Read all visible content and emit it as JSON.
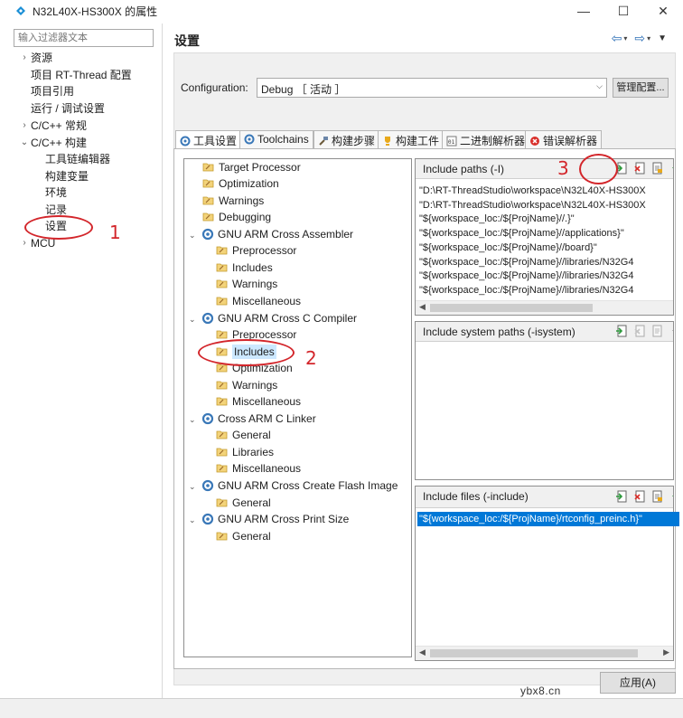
{
  "window": {
    "title": "N32L40X-HS300X 的属性",
    "controls": {
      "minimize": "—",
      "maximize": "☐",
      "close": "✕"
    }
  },
  "left": {
    "filter_placeholder": "输入过滤器文本",
    "items": [
      {
        "label": "资源",
        "arrow": "›"
      },
      {
        "label": "项目 RT-Thread 配置",
        "arrow": ""
      },
      {
        "label": "项目引用",
        "arrow": ""
      },
      {
        "label": "运行 / 调试设置",
        "arrow": ""
      },
      {
        "label": "C/C++ 常规",
        "arrow": "›"
      },
      {
        "label": "C/C++ 构建",
        "arrow": "⌄"
      },
      {
        "label": "工具链编辑器",
        "arrow": ""
      },
      {
        "label": "构建变量",
        "arrow": ""
      },
      {
        "label": "环境",
        "arrow": ""
      },
      {
        "label": "记录",
        "arrow": ""
      },
      {
        "label": "设置",
        "arrow": ""
      },
      {
        "label": "MCU",
        "arrow": "›"
      }
    ]
  },
  "header": {
    "title": "设置"
  },
  "config": {
    "label": "Configuration:",
    "value": "Debug ［ 活动 ］",
    "manage_button": "管理配置..."
  },
  "tabs": [
    {
      "label": "工具设置"
    },
    {
      "label": "Toolchains"
    },
    {
      "label": "构建步骤"
    },
    {
      "label": "构建工件"
    },
    {
      "label": "二进制解析器"
    },
    {
      "label": "错误解析器"
    }
  ],
  "tree": {
    "nodes": [
      {
        "label": "Target Processor"
      },
      {
        "label": "Optimization"
      },
      {
        "label": "Warnings"
      },
      {
        "label": "Debugging"
      },
      {
        "label": "GNU ARM Cross Assembler"
      },
      {
        "label": "Preprocessor"
      },
      {
        "label": "Includes"
      },
      {
        "label": "Warnings"
      },
      {
        "label": "Miscellaneous"
      },
      {
        "label": "GNU ARM Cross C Compiler"
      },
      {
        "label": "Preprocessor"
      },
      {
        "label": "Includes"
      },
      {
        "label": "Optimization"
      },
      {
        "label": "Warnings"
      },
      {
        "label": "Miscellaneous"
      },
      {
        "label": "Cross ARM C Linker"
      },
      {
        "label": "General"
      },
      {
        "label": "Libraries"
      },
      {
        "label": "Miscellaneous"
      },
      {
        "label": "GNU ARM Cross Create Flash Image"
      },
      {
        "label": "General"
      },
      {
        "label": "GNU ARM Cross Print Size"
      },
      {
        "label": "General"
      }
    ]
  },
  "include_paths": {
    "title": "Include paths (-I)",
    "items": [
      "\"D:\\RT-ThreadStudio\\workspace\\N32L40X-HS300X",
      "\"D:\\RT-ThreadStudio\\workspace\\N32L40X-HS300X",
      "\"${workspace_loc:/${ProjName}//.}\"",
      "\"${workspace_loc:/${ProjName}//applications}\"",
      "\"${workspace_loc:/${ProjName}//board}\"",
      "\"${workspace_loc:/${ProjName}//libraries/N32G4",
      "\"${workspace_loc:/${ProjName}//libraries/N32G4",
      "\"${workspace_loc:/${ProjName}//libraries/N32G4"
    ]
  },
  "include_system_paths": {
    "title": "Include system paths (-isystem)"
  },
  "include_files": {
    "title": "Include files (-include)",
    "items": [
      "\"${workspace_loc:/${ProjName}/rtconfig_preinc.h}\""
    ]
  },
  "apply_button": "应用(A)",
  "annotations": [
    "1",
    "2",
    "3"
  ],
  "watermark": "ybx8.cn"
}
